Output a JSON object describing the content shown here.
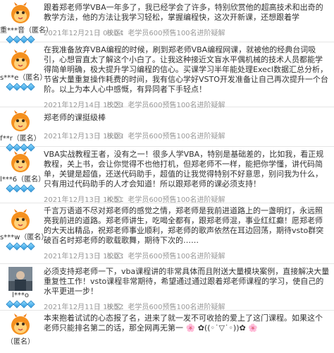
{
  "reviews": [
    {
      "user": "重***音（匿名）",
      "gems": 4,
      "text": "跟着郑老师学VBA一年多了，我已经学会了许多，特别欣赏他的超高技术和出奇的教学方法，他的方法让我学习轻松，掌握编程快，这次开新课，还想跟着学",
      "date": "2021年12月21日 09:04",
      "school": "校区：老学员600预售100名进阶疑解"
    },
    {
      "user": "s***e（匿名）",
      "gems": 4,
      "text": "在我准备放弃VBA编程的时候，刷到郑老师VBA编程网课，就被他的经典台词吸引，心想冒直太了解这个小白了。让我这种接近文盲水平偶机械的技术人员都能学得简单明确，极大提升学习编程的信心。买课学习半年能处理Execl数据汇总分析，节省大量重复操作耗费的时间，我有信心学好VSTO开发准备让自己再次提升一个台阶。以上为本人心中感慨，有异同者下手轻点！",
      "date": "2021年12月14日 13:29",
      "school": "校区：老学员600预售100名进阶疑解"
    },
    {
      "user": "f**r（匿名）",
      "gems": 4,
      "text": "郑老师的课挺级棒",
      "date": "2021年12月13日 19:09",
      "school": "校区：老学员600预售100名进阶疑解"
    },
    {
      "user": "l***6（匿名）",
      "gems": 4,
      "text": "VBA实战教程王者，没有之一！很多人学VBA，特别是基础差的，比如我，看正规教程，关上书，会让你觉得不也他打机，但郑老师不一样，能把你学懂，讲代码简单，关键是超值，还送代码助手，超值的让我觉得特别不好意思，别问我为什么，只有用过代码助手的人才会知道！所以跟郑老师的课必须支持！",
      "date": "2021年12月13日 14:51",
      "school": "校区：老学员600预售100名进阶疑解"
    },
    {
      "user": "s***w（匿名）",
      "gems": 4,
      "text": "千言万语道不尽对郑老师的感觉之情，郑老师是我前进道路上的一盏明灯，永远照亮我前进的道路。郑老师讲生，吃喝全都有，跟郑老师混，事业红红癫！愿郑老师的大天出精品，祝郑老师事业顺利，郑老师的歌声依然在耳边回荡，期待vsto群突破百名时郑老师的歌载歌舞，期待下次的……",
      "date": "2021年12月13日 11:03",
      "school": "校区：老学员600预售100名进阶疑解"
    },
    {
      "user": "l***o",
      "gems": 4,
      "text": "必须支持郑老师一下，vba课程讲的非常具体而且附送大量模块案例，直接解决大量重复性工作！vsto课程非常期待，希望通过通过跟着郑老师课程的学习，使自己的水平更进一步！",
      "date": "2021年12月11日 19:52",
      "school": "校区：老学员600预售100名进阶疑解"
    },
    {
      "user": "（匿名）",
      "gems": 0,
      "text": "本来抱着试试的心态报了名，进来了就一发不可收拾的爱上了这门课程。如果这个老师只能排名第二的话，那全网再无第一 🌸 ✿((◦˙▽˙◦))✿ 🌸",
      "date": "",
      "school": ""
    }
  ]
}
